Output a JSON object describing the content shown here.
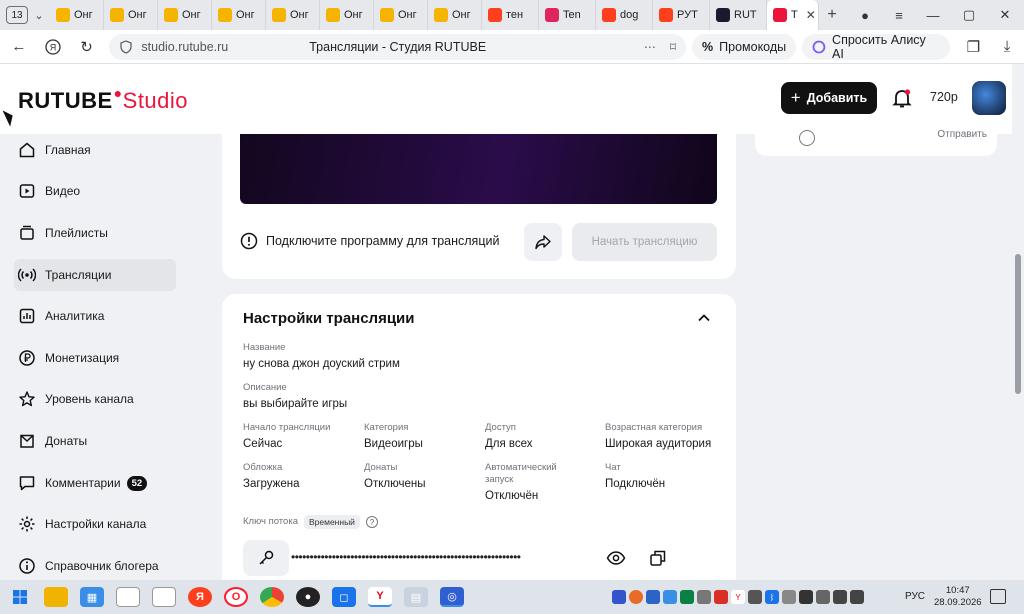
{
  "browser": {
    "tab_count": "13",
    "tabs": [
      {
        "label": "Онг",
        "color": "#f5b400"
      },
      {
        "label": "Онг",
        "color": "#f5b400"
      },
      {
        "label": "Онг",
        "color": "#f5b400"
      },
      {
        "label": "Онг",
        "color": "#f5b400"
      },
      {
        "label": "Онг",
        "color": "#f5b400"
      },
      {
        "label": "Онг",
        "color": "#f5b400"
      },
      {
        "label": "Онг",
        "color": "#f5b400"
      },
      {
        "label": "Онг",
        "color": "#f5b400"
      },
      {
        "label": "тен",
        "color": "#fc3f1d"
      },
      {
        "label": "Ten",
        "color": "#e0245e"
      },
      {
        "label": "dog",
        "color": "#fc3f1d"
      },
      {
        "label": "РУТ",
        "color": "#fc3f1d"
      },
      {
        "label": "RUT",
        "color": "#1a1a2e"
      }
    ],
    "active_tab": {
      "label": "Т",
      "color": "#ed143b"
    },
    "url_domain": "studio.rutube.ru",
    "page_title": "Трансляции - Студия RUTUBE",
    "promo_label": "Промокоды",
    "alice_label": "Спросить Алису AI"
  },
  "header": {
    "logo_main": "RUTUBE",
    "logo_studio": "Studio",
    "add_label": "Добавить",
    "quality": "720p"
  },
  "sidebar": {
    "items": [
      {
        "label": "Главная"
      },
      {
        "label": "Видео"
      },
      {
        "label": "Плейлисты"
      },
      {
        "label": "Трансляции"
      },
      {
        "label": "Аналитика"
      },
      {
        "label": "Монетизация"
      },
      {
        "label": "Уровень канала"
      },
      {
        "label": "Донаты"
      },
      {
        "label": "Комментарии",
        "badge": "52"
      },
      {
        "label": "Настройки канала"
      },
      {
        "label": "Справочник блогера"
      }
    ]
  },
  "stream": {
    "warning": "Подключите программу для трансляций",
    "start_label": "Начать трансляцию"
  },
  "chat": {
    "send_label": "Отправить"
  },
  "settings": {
    "title": "Настройки трансляции",
    "name_label": "Название",
    "name_value": "ну снова джон доуский стрим",
    "desc_label": "Описание",
    "desc_value": "вы выбирайте игры",
    "start_label": "Начало трансляции",
    "start_value": "Сейчас",
    "category_label": "Категория",
    "category_value": "Видеоигры",
    "access_label": "Доступ",
    "access_value": "Для всех",
    "age_label": "Возрастная категория",
    "age_value": "Широкая аудитория",
    "cover_label": "Обложка",
    "cover_value": "Загружена",
    "donates_label": "Донаты",
    "donates_value": "Отключены",
    "autostart_label": "Автоматический запуск",
    "autostart_value": "Отключён",
    "chat_label": "Чат",
    "chat_value": "Подключён",
    "key_label": "Ключ потока",
    "key_tag": "Временный",
    "key_masked": "••••••••••••••••••••••••••••••••••••••••••••••••••••••••••••••"
  },
  "taskbar": {
    "lang": "РУС",
    "time": "10:47",
    "date": "28.09.2026"
  },
  "colors": {
    "brand_red": "#ed143b",
    "dark": "#111111"
  }
}
